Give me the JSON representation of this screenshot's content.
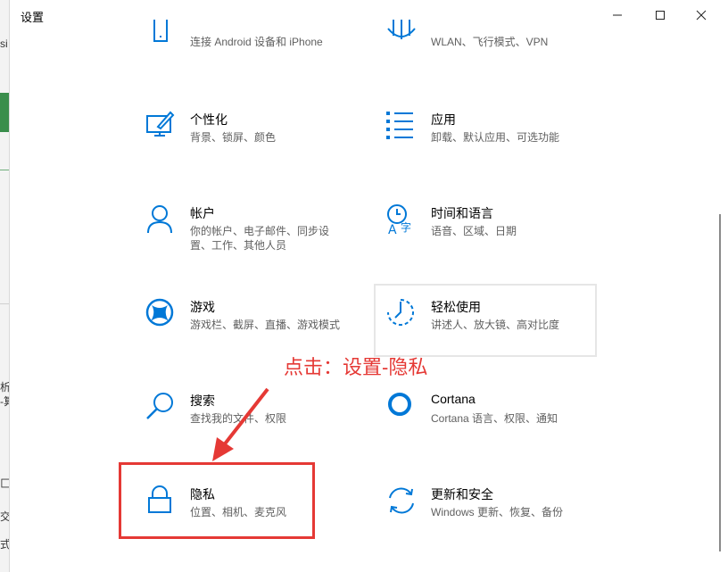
{
  "window": {
    "title": "设置",
    "controls": [
      "minimize",
      "maximize",
      "close"
    ]
  },
  "tiles": [
    {
      "name": "",
      "desc": "连接 Android 设备和 iPhone",
      "icon": "phone-icon"
    },
    {
      "name": "",
      "desc": "WLAN、飞行模式、VPN",
      "icon": "globe-icon"
    },
    {
      "name": "个性化",
      "desc": "背景、锁屏、颜色",
      "icon": "personalization-icon"
    },
    {
      "name": "应用",
      "desc": "卸载、默认应用、可选功能",
      "icon": "apps-icon"
    },
    {
      "name": "帐户",
      "desc": "你的帐户、电子邮件、同步设置、工作、其他人员",
      "icon": "account-icon"
    },
    {
      "name": "时间和语言",
      "desc": "语音、区域、日期",
      "icon": "time-language-icon"
    },
    {
      "name": "游戏",
      "desc": "游戏栏、截屏、直播、游戏模式",
      "icon": "xbox-icon"
    },
    {
      "name": "轻松使用",
      "desc": "讲述人、放大镜、高对比度",
      "icon": "ease-of-access-icon"
    },
    {
      "name": "搜索",
      "desc": "查找我的文件、权限",
      "icon": "search-icon"
    },
    {
      "name": "Cortana",
      "desc": "Cortana 语言、权限、通知",
      "icon": "cortana-icon"
    },
    {
      "name": "隐私",
      "desc": "位置、相机、麦克风",
      "icon": "lock-icon"
    },
    {
      "name": "更新和安全",
      "desc": "Windows 更新、恢复、备份",
      "icon": "update-icon"
    }
  ],
  "annotation": {
    "text": "点击：设置-隐私",
    "color": "#e53935"
  },
  "accent_color": "#0078d7",
  "background_window": {
    "fragments": [
      "si",
      "析",
      "-算",
      "匚",
      "交",
      "式"
    ]
  }
}
